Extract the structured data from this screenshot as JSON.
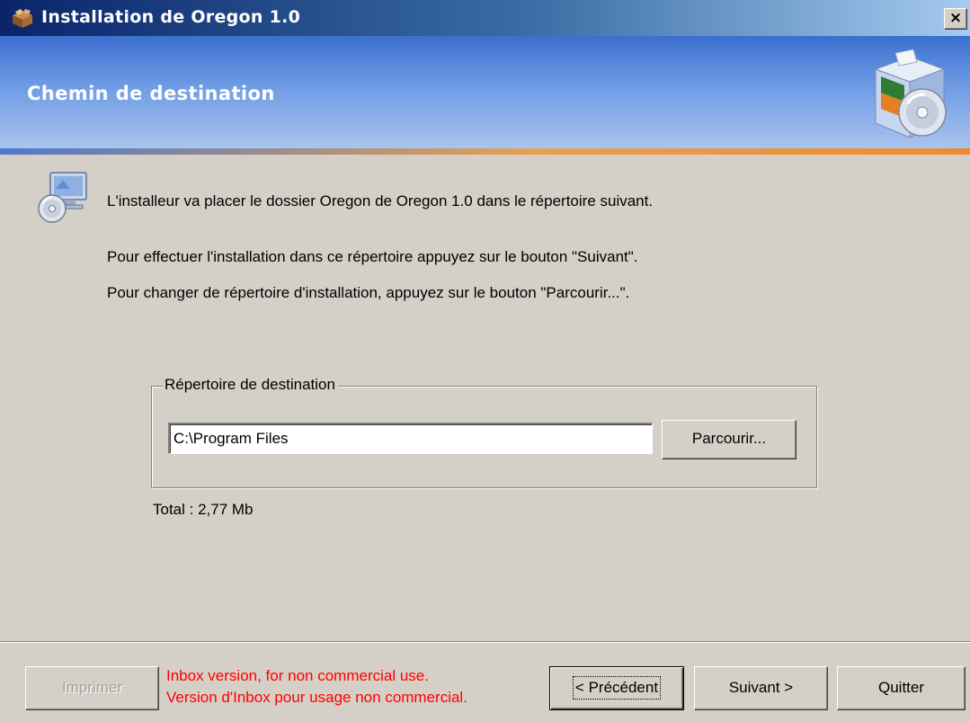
{
  "window": {
    "title": "Installation de Oregon 1.0",
    "close_label": "×"
  },
  "banner": {
    "title": "Chemin de destination"
  },
  "content": {
    "intro": "L'installeur va placer le dossier Oregon de Oregon 1.0 dans le répertoire suivant.",
    "instruction_next": "Pour effectuer l'installation dans ce répertoire appuyez sur le bouton \"Suivant\".",
    "instruction_browse": "Pour changer de répertoire d'installation, appuyez sur le bouton \"Parcourir...\"."
  },
  "destination": {
    "group_label": "Répertoire de destination",
    "path_value": "C:\\Program Files",
    "browse_label": "Parcourir..."
  },
  "total_label": "Total : 2,77 Mb",
  "footer": {
    "print_label": "Imprimer",
    "notice_line1": "Inbox version, for non commercial use.",
    "notice_line2": "Version d'Inbox pour usage non commercial.",
    "back_label": "< Précédent",
    "next_label": "Suivant >",
    "quit_label": "Quitter"
  },
  "colors": {
    "dialog_bg": "#d4d0c8",
    "titlebar_start": "#0a246a",
    "titlebar_end": "#a6caf0",
    "banner_top": "#3b6fcf",
    "accent_stripe": "#ef8a30",
    "notice_text": "#ff0000"
  },
  "icons": {
    "title": "installer-box-icon",
    "banner": "software-box-cd-icon",
    "content": "computer-cd-icon"
  }
}
